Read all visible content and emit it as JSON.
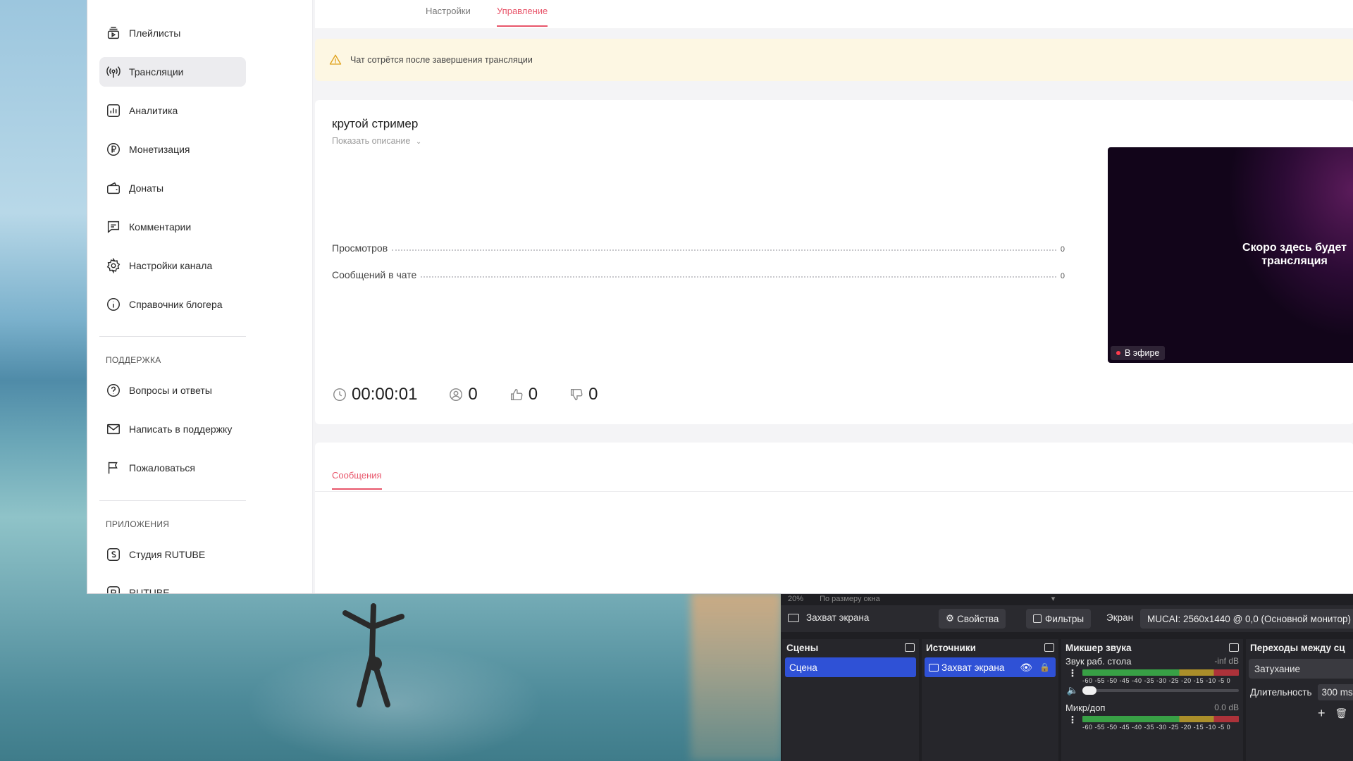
{
  "sidebar": {
    "items": [
      {
        "id": "playlists",
        "label": "Плейлисты",
        "icon": "playlist-icon"
      },
      {
        "id": "streams",
        "label": "Трансляции",
        "icon": "broadcast-icon",
        "active": true
      },
      {
        "id": "analytics",
        "label": "Аналитика",
        "icon": "bar-chart-icon"
      },
      {
        "id": "monetization",
        "label": "Монетизация",
        "icon": "ruble-icon"
      },
      {
        "id": "donations",
        "label": "Донаты",
        "icon": "wallet-icon"
      },
      {
        "id": "comments",
        "label": "Комментарии",
        "icon": "comment-icon"
      },
      {
        "id": "channel-settings",
        "label": "Настройки канала",
        "icon": "gear-icon"
      },
      {
        "id": "blogger-guide",
        "label": "Справочник блогера",
        "icon": "info-icon"
      }
    ],
    "support_title": "ПОДДЕРЖКА",
    "support_items": [
      {
        "id": "faq",
        "label": "Вопросы и ответы",
        "icon": "question-icon"
      },
      {
        "id": "write-support",
        "label": "Написать в поддержку",
        "icon": "mail-icon"
      },
      {
        "id": "report",
        "label": "Пожаловаться",
        "icon": "flag-icon"
      }
    ],
    "apps_title": "ПРИЛОЖЕНИЯ",
    "apps_items": [
      {
        "id": "studio",
        "label": "Студия RUTUBE",
        "icon": "studio-icon"
      },
      {
        "id": "rutube",
        "label": "RUTUBE",
        "icon": "rutube-icon"
      }
    ]
  },
  "tabs": {
    "settings": "Настройки",
    "manage": "Управление"
  },
  "warning": {
    "text": "Чат сотрётся после завершения трансляции"
  },
  "stream": {
    "title": "крутой стример",
    "show_description": "Показать описание",
    "stats": [
      {
        "label": "Просмотров",
        "value": "0"
      },
      {
        "label": "Сообщений в чате",
        "value": "0"
      }
    ],
    "duration": "00:00:01",
    "viewers": "0",
    "likes": "0",
    "dislikes": "0"
  },
  "preview": {
    "text": "Скоро здесь будет трансляция",
    "live_label": "В эфире"
  },
  "chat": {
    "tab_label": "Сообщения"
  },
  "obs": {
    "zoom_label": "20%",
    "zoom_mode": "По размеру окна",
    "selected_source": "Захват экрана",
    "properties": "Свойства",
    "filters": "Фильтры",
    "screen_label": "Экран",
    "screen_value": "MUCAI: 2560x1440 @ 0,0 (Основной монитор)",
    "docks": {
      "scenes": {
        "title": "Сцены",
        "items": [
          "Сцена"
        ]
      },
      "sources": {
        "title": "Источники",
        "items": [
          "Захват экрана"
        ]
      },
      "mixer": {
        "title": "Микшер звука",
        "channels": [
          {
            "name": "Звук раб. стола",
            "level": "-inf dB"
          },
          {
            "name": "Микр/доп",
            "level": "0.0 dB"
          }
        ],
        "scale": "-60 -55 -50 -45 -40 -35 -30 -25 -20 -15 -10 -5 0"
      },
      "transitions": {
        "title": "Переходы между сц",
        "type": "Затухание",
        "duration_label": "Длительность",
        "duration_value": "300 ms"
      }
    }
  }
}
